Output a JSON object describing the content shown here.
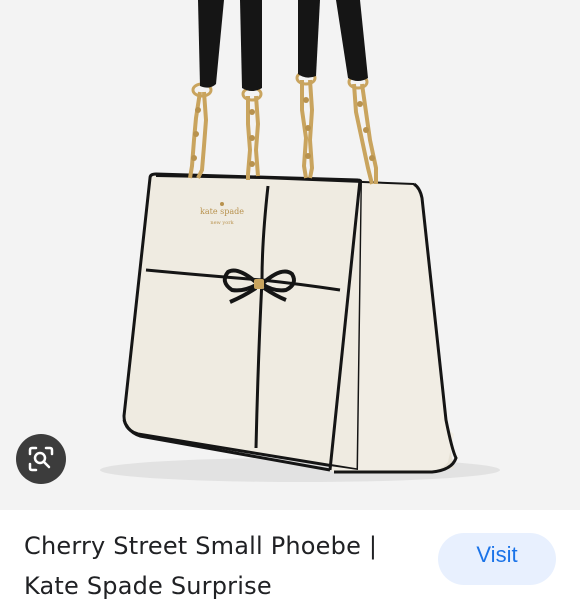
{
  "product_image": {
    "brand_label": "kate spade new york",
    "image_alt": "Cherry Street Small Phoebe handbag"
  },
  "lens_button": {
    "icon": "lens-search-icon"
  },
  "result": {
    "title": "Cherry Street Small Phoebe | Kate Spade Surprise"
  },
  "visit_button": {
    "label": "Visit"
  },
  "colors": {
    "image_background": "#f3f3f3",
    "bag_body": "#efebe1",
    "bag_trim": "#151515",
    "chain": "#c9a45e",
    "lens_button_bg": "#3c3c3c",
    "visit_bg": "#e8f0fe",
    "visit_text": "#1a73e8",
    "title_text": "#202124"
  }
}
